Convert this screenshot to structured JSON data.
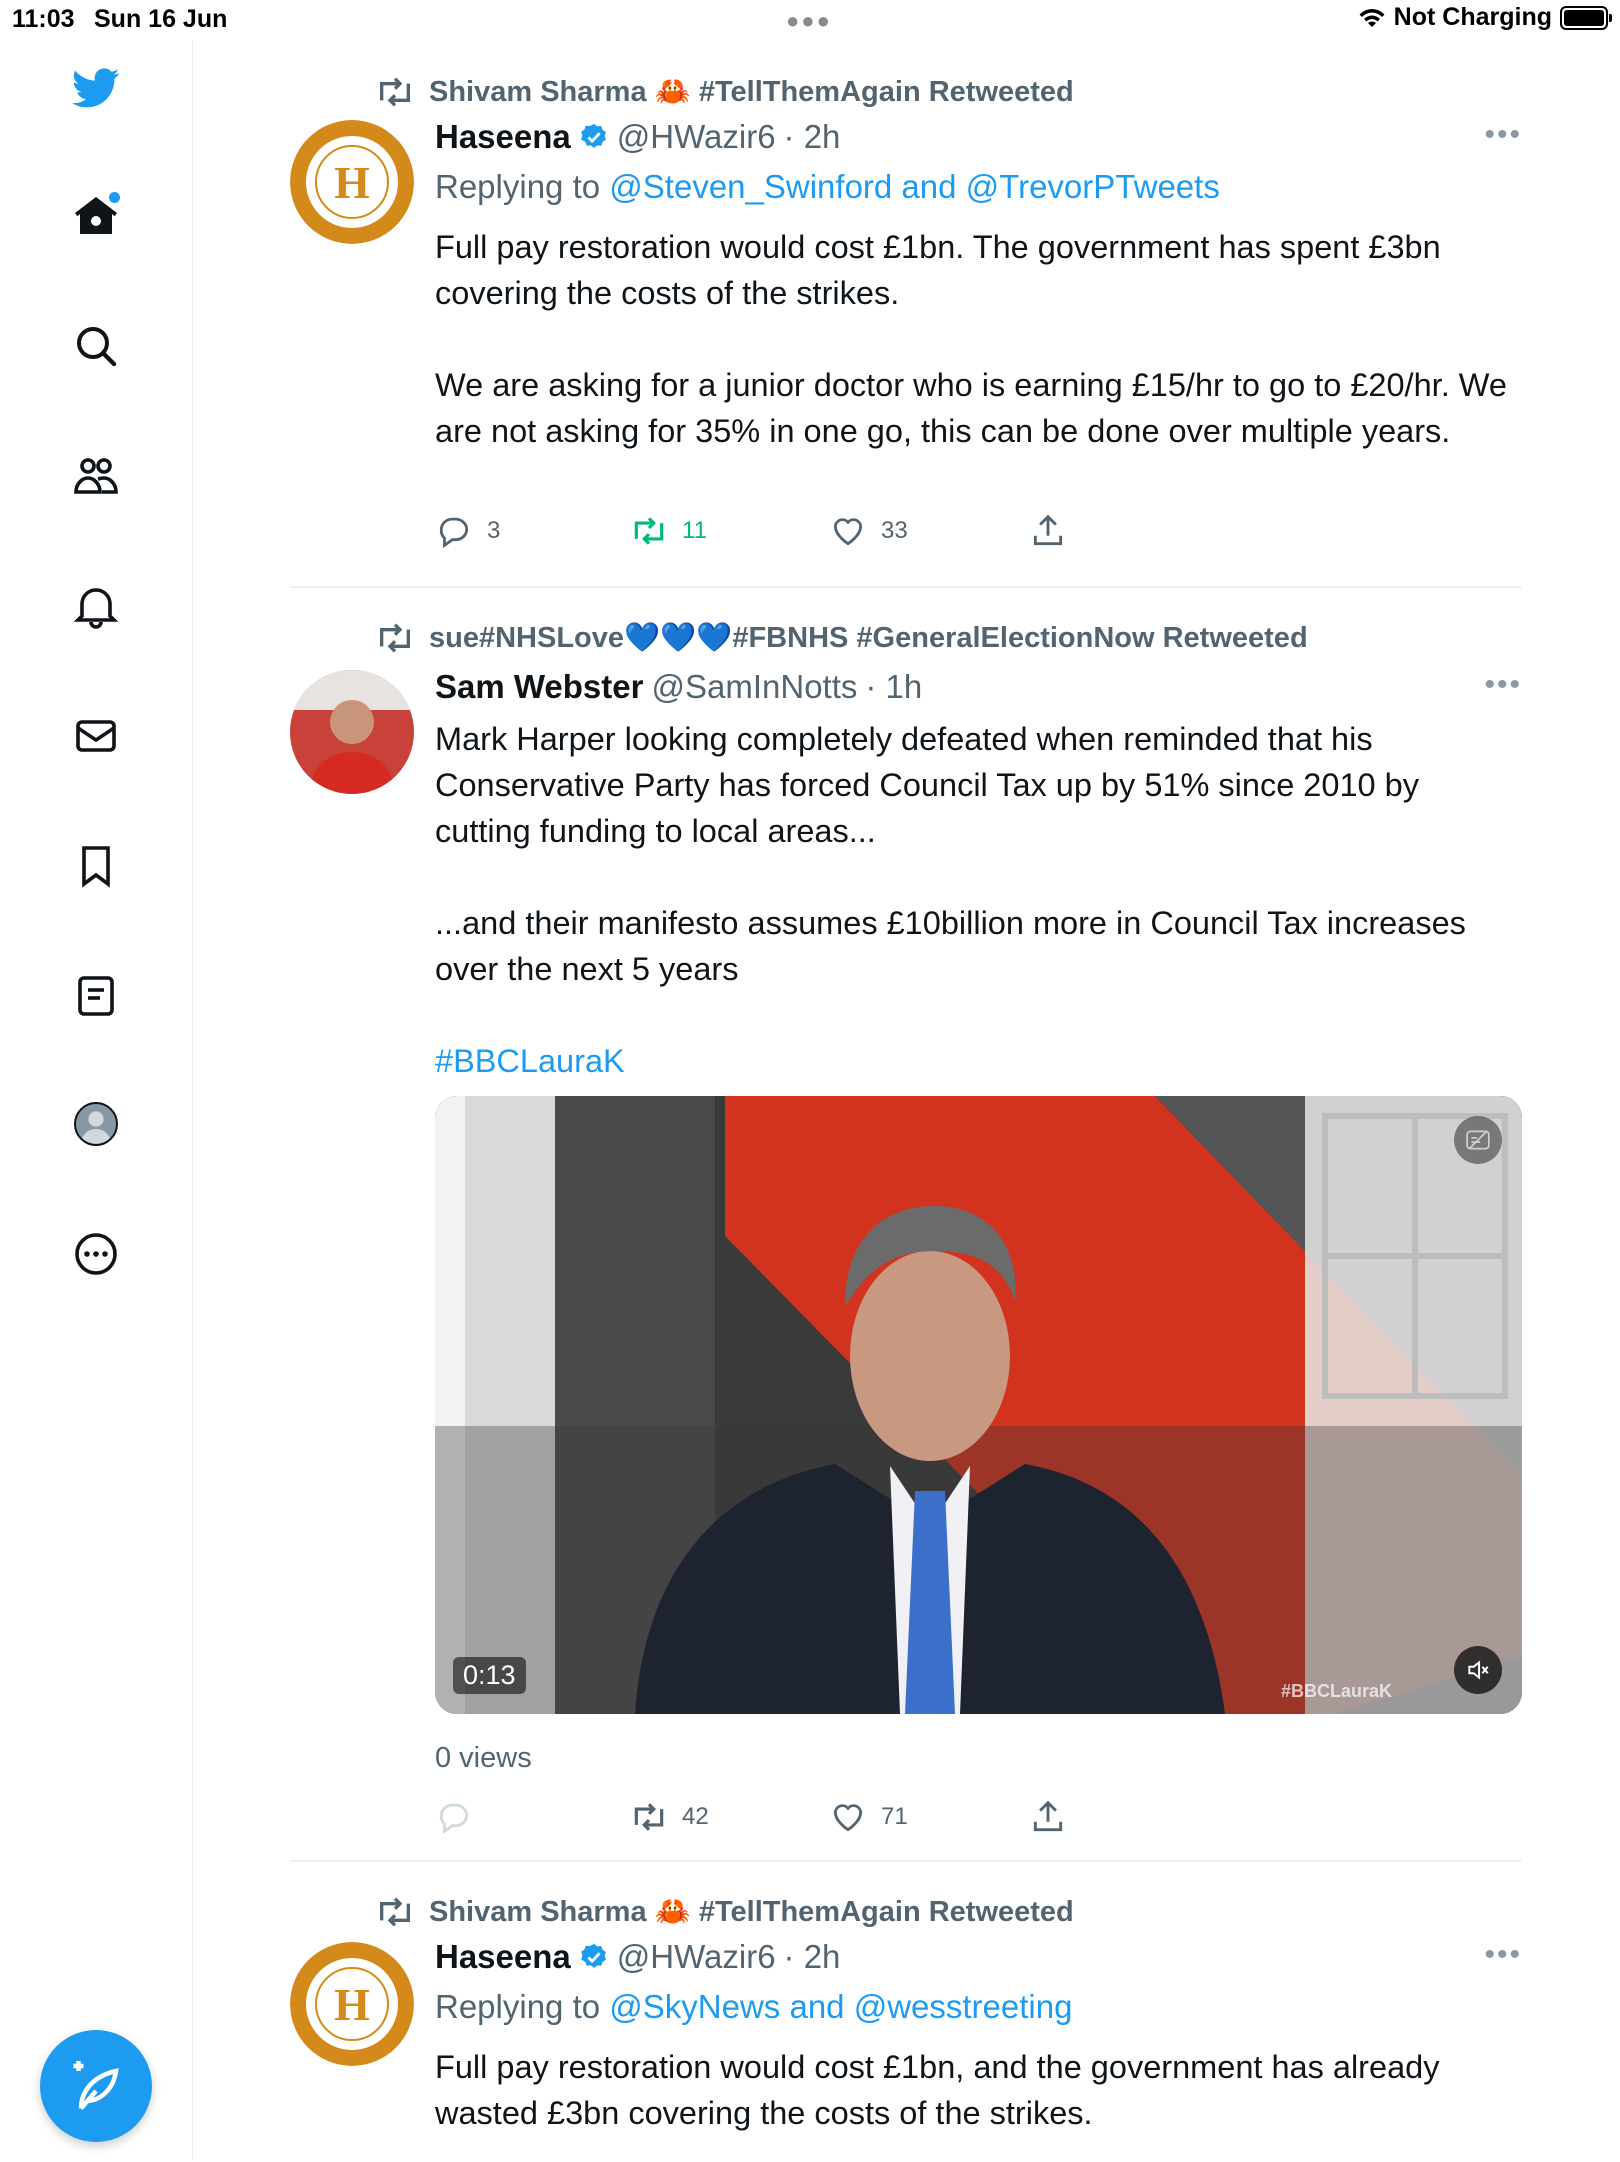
{
  "status_bar": {
    "time": "11:03",
    "date": "Sun 16 Jun",
    "charging": "Not Charging"
  },
  "sidebar": {
    "items": [
      {
        "name": "twitter-logo-icon"
      },
      {
        "name": "home-icon",
        "has_notification_dot": true
      },
      {
        "name": "search-icon"
      },
      {
        "name": "communities-icon"
      },
      {
        "name": "notifications-bell-icon"
      },
      {
        "name": "messages-envelope-icon"
      },
      {
        "name": "bookmarks-icon"
      },
      {
        "name": "lists-icon"
      },
      {
        "name": "profile-avatar-icon"
      },
      {
        "name": "more-circle-icon"
      }
    ],
    "accent_color": "#1d9bf0"
  },
  "tweets": [
    {
      "retweeted_by": "Shivam Sharma 🦀 #TellThemAgain Retweeted",
      "name": "Haseena",
      "verified": true,
      "handle": "@HWazir6",
      "time": "· 2h",
      "replying_label": "Replying to",
      "replying_to": "@Steven_Swinford and @TrevorPTweets",
      "body_p1": "Full pay restoration would cost £1bn. The government has spent £3bn covering the costs of the strikes.",
      "body_p2": "We are asking for a junior doctor who is earning £15/hr to go to £20/hr. We are not asking for 35% in one go, this can be done over multiple years.",
      "replies": "3",
      "retweets": "11",
      "likes": "33",
      "retweeted_by_me": true
    },
    {
      "retweeted_by": "sue#NHSLove💙💙💙#FBNHS #GeneralElectionNow Retweeted",
      "name": "Sam Webster",
      "verified": false,
      "handle": "@SamInNotts",
      "time": "· 1h",
      "body_p1": "Mark Harper looking completely defeated when reminded that his Conservative Party has forced Council Tax up by 51% since 2010 by cutting  funding to local areas...",
      "body_p2": "...and their manifesto assumes £10billion more in Council Tax increases over the next 5 years",
      "hashtag": "#BBCLauraK",
      "video_duration": "0:13",
      "video_watermark": "#BBCLauraK",
      "views": "0 views",
      "replies": "",
      "retweets": "42",
      "likes": "71"
    },
    {
      "retweeted_by": "Shivam Sharma 🦀 #TellThemAgain Retweeted",
      "name": "Haseena",
      "verified": true,
      "handle": "@HWazir6",
      "time": "· 2h",
      "replying_label": "Replying to",
      "replying_to": "@SkyNews and @wesstreeting",
      "body_p1": "Full pay restoration would cost £1bn, and the government has already wasted £3bn covering the costs of the strikes."
    }
  ]
}
